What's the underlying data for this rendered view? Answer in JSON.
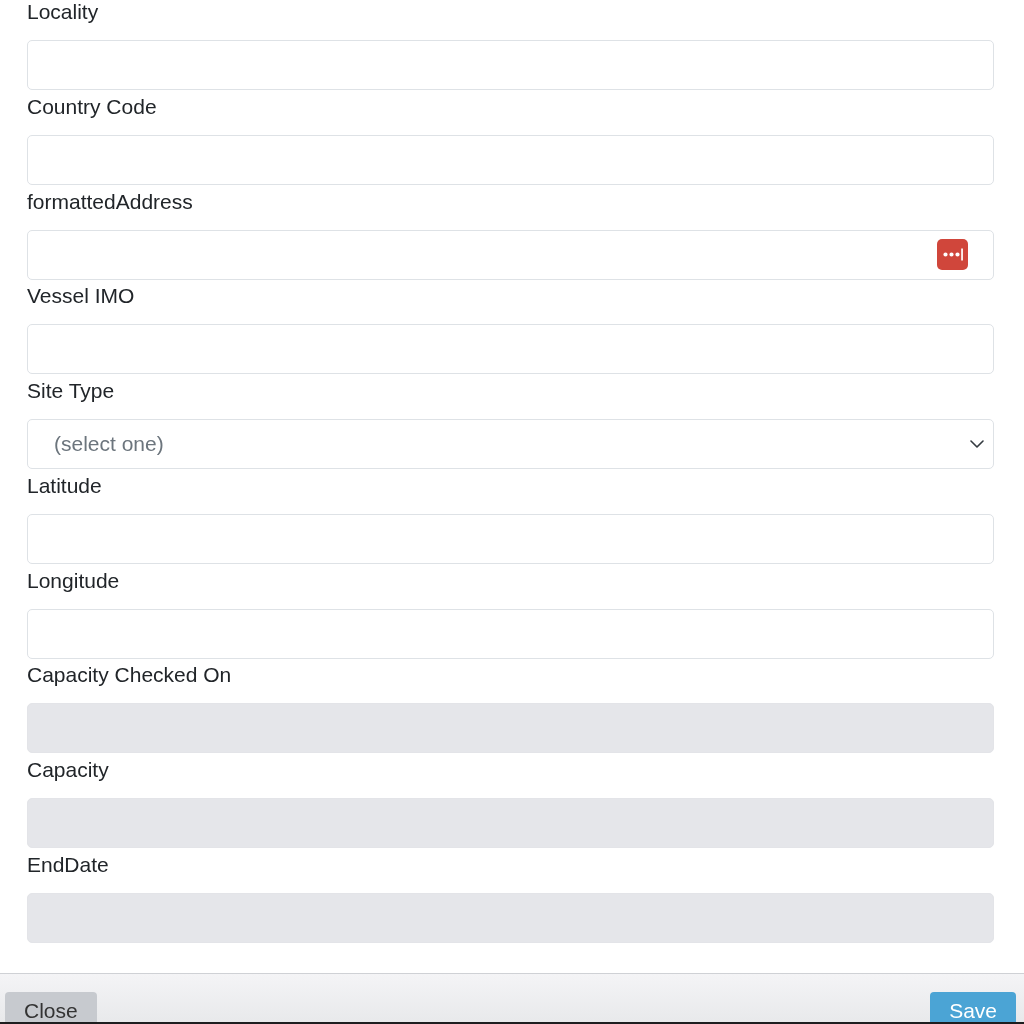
{
  "fields": [
    {
      "label": "Locality",
      "kind": "text",
      "disabled": false
    },
    {
      "label": "Country Code",
      "kind": "text",
      "disabled": false
    },
    {
      "label": "formattedAddress",
      "kind": "text-autofill",
      "disabled": false
    },
    {
      "label": "Vessel IMO",
      "kind": "text",
      "disabled": false
    },
    {
      "label": "Site Type",
      "kind": "select",
      "placeholder": "(select one)",
      "disabled": false
    },
    {
      "label": "Latitude",
      "kind": "text",
      "disabled": false
    },
    {
      "label": "Longitude",
      "kind": "text",
      "disabled": false
    },
    {
      "label": "Capacity Checked On",
      "kind": "text",
      "disabled": true
    },
    {
      "label": "Capacity",
      "kind": "text",
      "disabled": true
    },
    {
      "label": "EndDate",
      "kind": "text",
      "disabled": true
    }
  ],
  "footer": {
    "buttons": [
      {
        "label": "Close",
        "kind": "secondary"
      },
      {
        "label": "Save",
        "kind": "primary"
      }
    ]
  }
}
